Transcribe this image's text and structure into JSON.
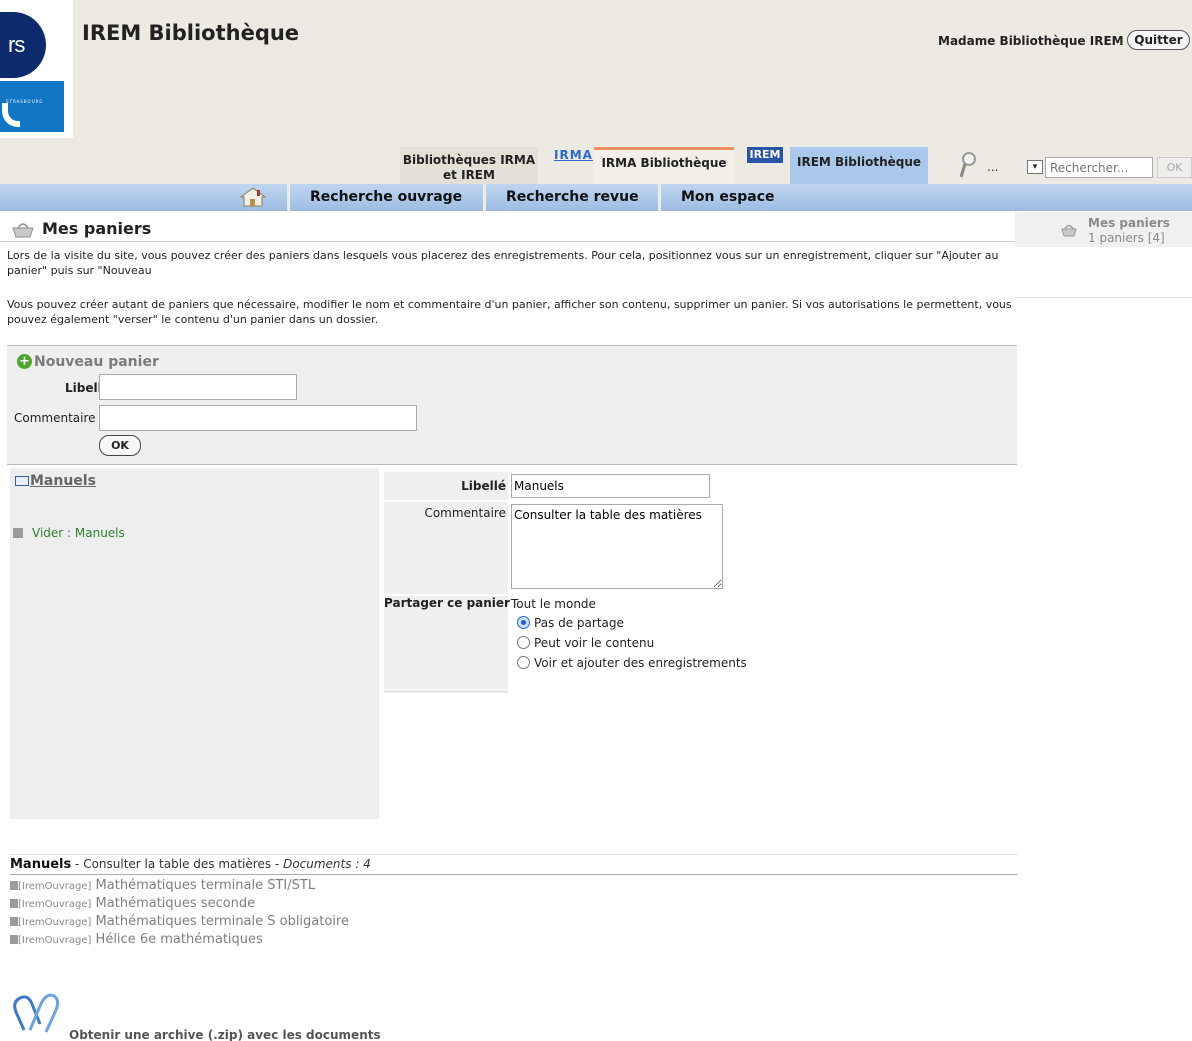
{
  "header": {
    "logo_text": "rs",
    "logo_small": "STRASBOURG",
    "title": "IREM Bibliothèque",
    "user": "Madame Bibliothèque IREM",
    "quit_label": "Quitter"
  },
  "library_tabs": {
    "tab1_label": "Bibliothèques IRMA et IREM",
    "irma_logo": "IRMA",
    "tab2_label": "IRMA Bibliothèque",
    "irem_logo": "IREM",
    "tab3_label": "IREM Bibliothèque"
  },
  "search": {
    "more_label": "...",
    "selector_glyph": "▾",
    "placeholder": "Rechercher...",
    "ok_label": "OK"
  },
  "nav": {
    "items": [
      "Recherche ouvrage",
      "Recherche revue",
      "Mon espace"
    ]
  },
  "right_panel": {
    "title": "Mes paniers",
    "count": "1 paniers [4]"
  },
  "page": {
    "title": "Mes paniers",
    "intro1": "Lors de la visite du site, vous pouvez créer des paniers dans lesquels vous placerez des enregistrements. Pour cela, positionnez vous sur un enregistrement, cliquer sur \"Ajouter au panier\" puis sur \"Nouveau",
    "intro2": "Vous pouvez créer autant de paniers que nécessaire, modifier le nom et commentaire d'un panier, afficher son contenu, supprimer un panier. Si vos autorisations le permettent, vous pouvez également \"verser\" le contenu d'un panier dans un dossier."
  },
  "new_basket": {
    "title": "Nouveau panier",
    "libelle_label": "Libellé",
    "comment_label": "Commentaire",
    "libelle_value": "",
    "comment_value": "",
    "ok_label": "OK"
  },
  "basket": {
    "name": "Manuels",
    "empty_link": "Vider : Manuels",
    "libelle_label": "Libellé",
    "libelle_value": "Manuels",
    "comment_label": "Commentaire",
    "comment_value": "Consulter la table des matières",
    "share_label": "Partager ce panier",
    "share_all": "Tout le monde",
    "share_options": [
      "Pas de partage",
      "Peut voir le contenu",
      "Voir et ajouter des enregistrements"
    ],
    "share_selected": "Pas de partage"
  },
  "contents": {
    "name": "Manuels",
    "sep1": " - ",
    "comment": "Consulter la table des matières",
    "sep2": " - ",
    "count": "Documents : 4",
    "docs": [
      {
        "tag": "[IremOuvrage]",
        "title": "Mathématiques terminale STI/STL"
      },
      {
        "tag": "[IremOuvrage]",
        "title": "Mathématiques seconde"
      },
      {
        "tag": "[IremOuvrage]",
        "title": "Mathématiques terminale S obligatoire"
      },
      {
        "tag": "[IremOuvrage]",
        "title": "Hélice 6e mathématiques"
      }
    ],
    "zip_label": "Obtenir une archive (.zip) avec les documents"
  }
}
